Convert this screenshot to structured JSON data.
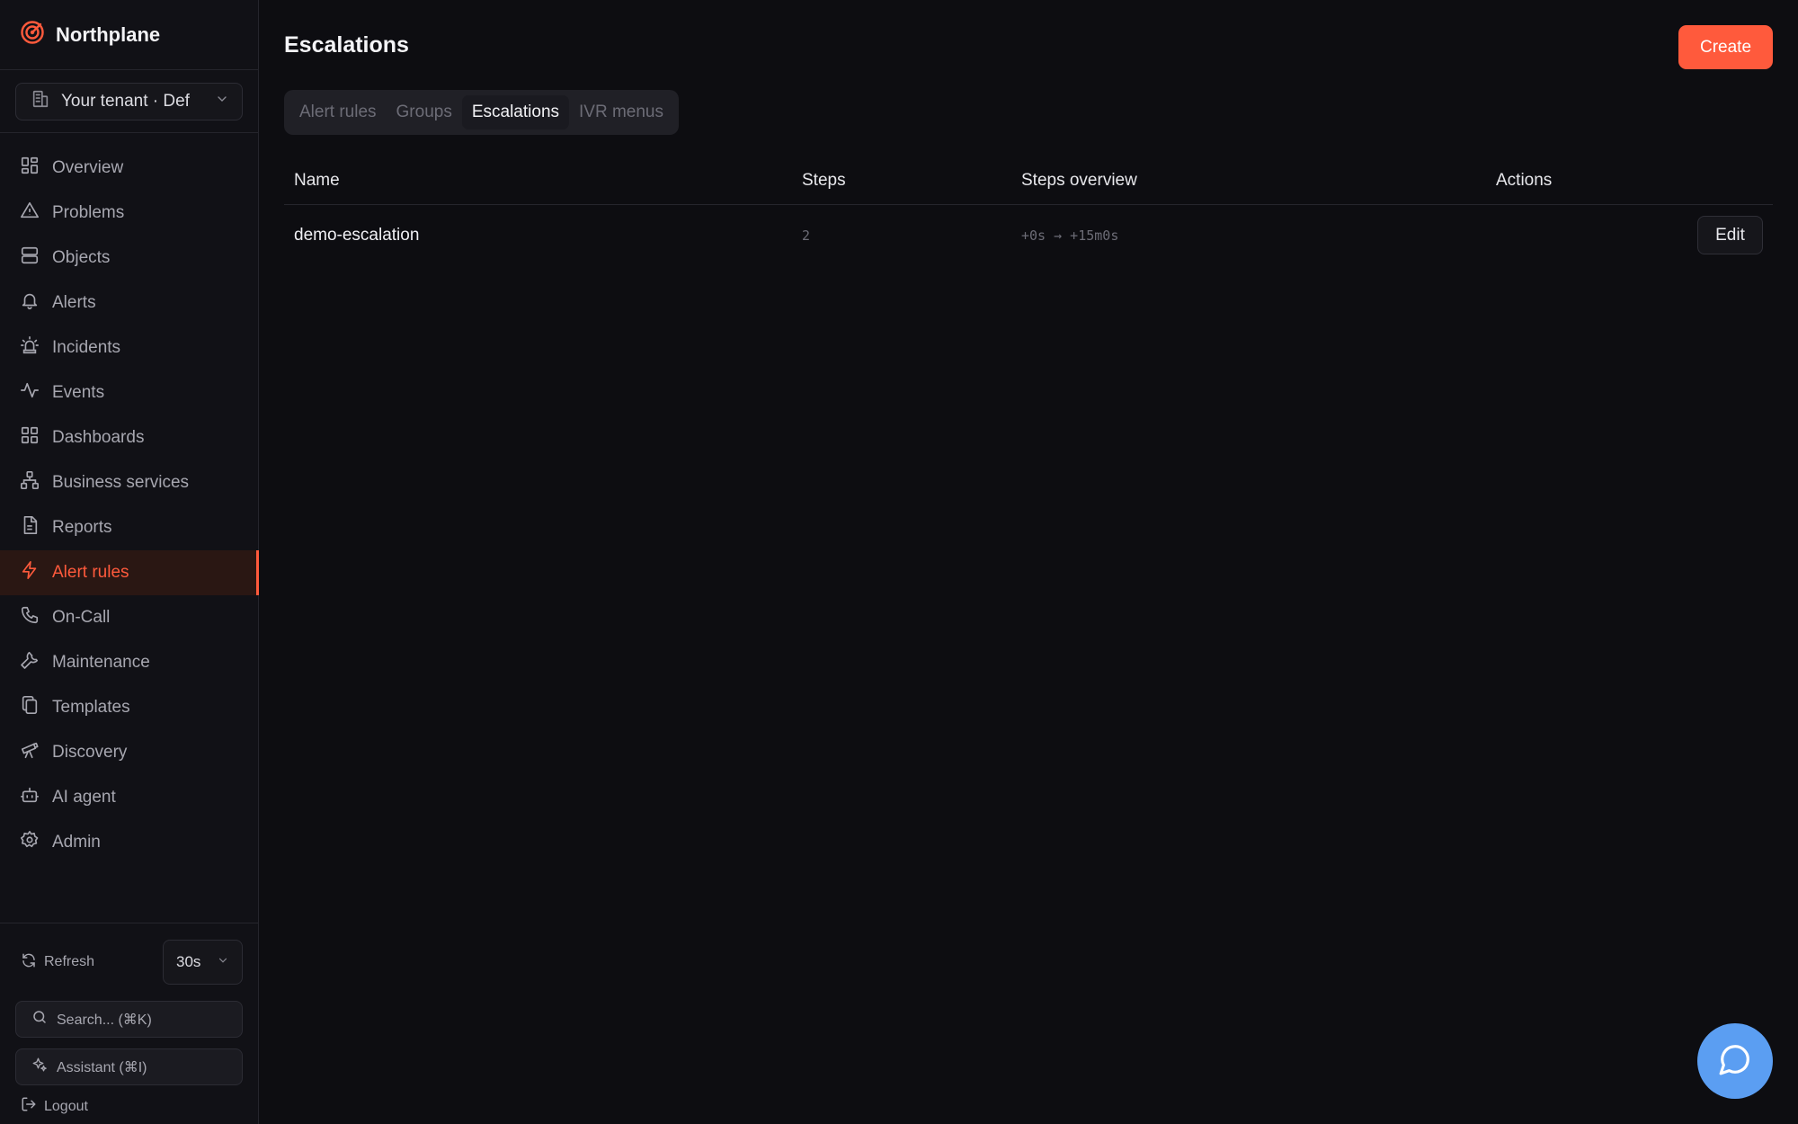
{
  "brand": {
    "name": "Northplane",
    "accent": "#ff5a3c"
  },
  "tenant": {
    "label": "Your tenant · Def"
  },
  "sidebar": {
    "items": [
      {
        "label": "Overview",
        "icon": "grid-icon"
      },
      {
        "label": "Problems",
        "icon": "warning-icon"
      },
      {
        "label": "Objects",
        "icon": "server-icon"
      },
      {
        "label": "Alerts",
        "icon": "bell-icon"
      },
      {
        "label": "Incidents",
        "icon": "siren-icon"
      },
      {
        "label": "Events",
        "icon": "activity-icon"
      },
      {
        "label": "Dashboards",
        "icon": "dashboard-icon"
      },
      {
        "label": "Business services",
        "icon": "network-icon"
      },
      {
        "label": "Reports",
        "icon": "document-icon"
      },
      {
        "label": "Alert rules",
        "icon": "bolt-icon",
        "active": true
      },
      {
        "label": "On-Call",
        "icon": "phone-icon"
      },
      {
        "label": "Maintenance",
        "icon": "wrench-icon"
      },
      {
        "label": "Templates",
        "icon": "copy-icon"
      },
      {
        "label": "Discovery",
        "icon": "telescope-icon"
      },
      {
        "label": "AI agent",
        "icon": "bot-icon"
      },
      {
        "label": "Admin",
        "icon": "gear-icon"
      }
    ],
    "refresh_label": "Refresh",
    "interval_value": "30s",
    "search_label": "Search... (⌘K)",
    "assistant_label": "Assistant (⌘I)",
    "logout_label": "Logout"
  },
  "page": {
    "title": "Escalations",
    "create_label": "Create",
    "tabs": [
      {
        "label": "Alert rules"
      },
      {
        "label": "Groups"
      },
      {
        "label": "Escalations",
        "active": true
      },
      {
        "label": "IVR menus"
      }
    ]
  },
  "table": {
    "columns": [
      "Name",
      "Steps",
      "Steps overview",
      "Actions"
    ],
    "rows": [
      {
        "name": "demo-escalation",
        "steps": "2",
        "overview": "+0s → +15m0s",
        "action": "Edit"
      }
    ]
  },
  "colors": {
    "accent": "#ff5a3c",
    "chat_fab": "#5b9ef2",
    "background": "#0d0d11"
  }
}
